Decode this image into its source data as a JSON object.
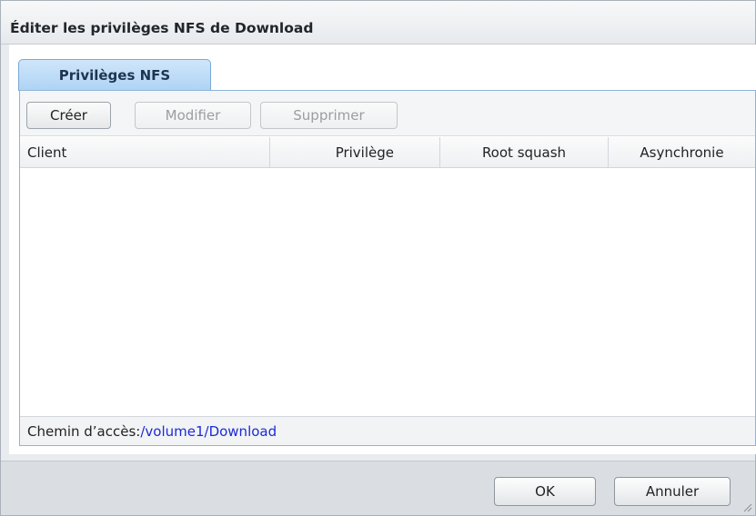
{
  "dialog": {
    "title": "Éditer les privilèges NFS de Download"
  },
  "tabs": [
    {
      "label": "Privilèges NFS",
      "active": true
    }
  ],
  "toolbar": {
    "create_label": "Créer",
    "modify_label": "Modifier",
    "delete_label": "Supprimer"
  },
  "grid": {
    "columns": [
      "Client",
      "Privilège",
      "Root squash",
      "Asynchronie"
    ],
    "rows": []
  },
  "path": {
    "label": "Chemin d’accès:",
    "value": "/volume1/Download"
  },
  "footer": {
    "ok_label": "OK",
    "cancel_label": "Annuler"
  },
  "icons": {
    "resize": "resize-grip-icon"
  },
  "colors": {
    "tab_fill": "#aed3f4",
    "tab_border": "#7aa9d6",
    "path_link": "#1a2bd6",
    "footer_bg": "#dadee2"
  }
}
